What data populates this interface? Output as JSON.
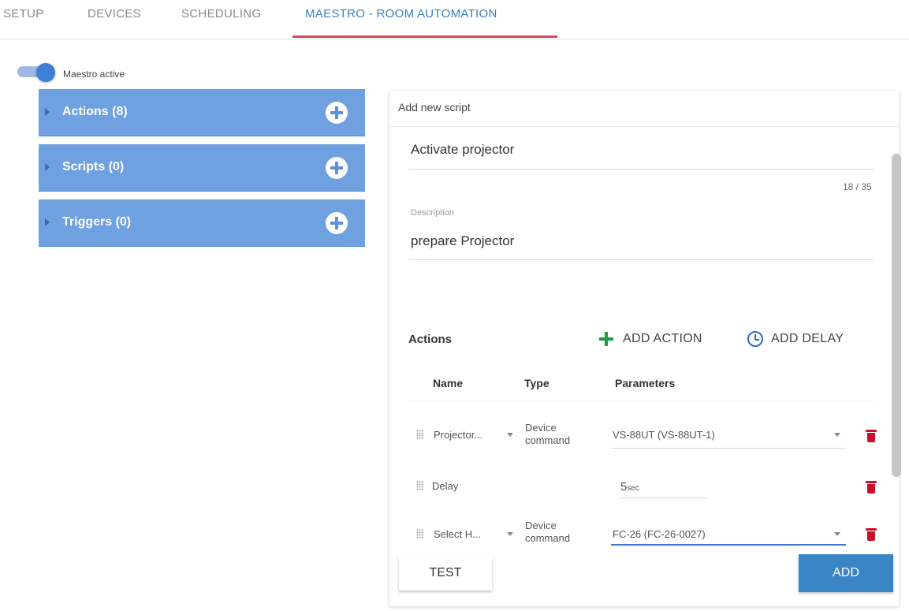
{
  "tabs": [
    {
      "label": "SETUP"
    },
    {
      "label": "DEVICES"
    },
    {
      "label": "SCHEDULING"
    },
    {
      "label": "MAESTRO - ROOM AUTOMATION",
      "active": true
    }
  ],
  "toggle": {
    "label": "Maestro active",
    "on": true
  },
  "panels": [
    {
      "title": "Actions (8)"
    },
    {
      "title": "Scripts (0)"
    },
    {
      "title": "Triggers (0)"
    }
  ],
  "form": {
    "title": "Add new script",
    "name_value": "Activate projector",
    "name_counter": "18 / 35",
    "description_label": "Description",
    "description_value": "prepare Projector"
  },
  "actions": {
    "section_title": "Actions",
    "add_action_label": "ADD ACTION",
    "add_delay_label": "ADD DELAY",
    "columns": {
      "name": "Name",
      "type": "Type",
      "parameters": "Parameters"
    },
    "rows": [
      {
        "name": "Projector...",
        "type_line1": "Device",
        "type_line2": "command",
        "parameter": "VS-88UT (VS-88UT-1)"
      },
      {
        "name": "Delay",
        "delay_value": "5",
        "delay_unit": "sec"
      },
      {
        "name": "Select H...",
        "type_line1": "Device",
        "type_line2": "command",
        "parameter": "FC-26 (FC-26-0027)"
      }
    ]
  },
  "buttons": {
    "test": "TEST",
    "add": "ADD"
  },
  "colors": {
    "accent_tab": "#3a7fc0",
    "tab_underline": "#e0455f",
    "panel": "#6fa0df",
    "add_button": "#3a85c6",
    "delete": "#c8102e",
    "add_action_plus": "#1e9b3a"
  }
}
